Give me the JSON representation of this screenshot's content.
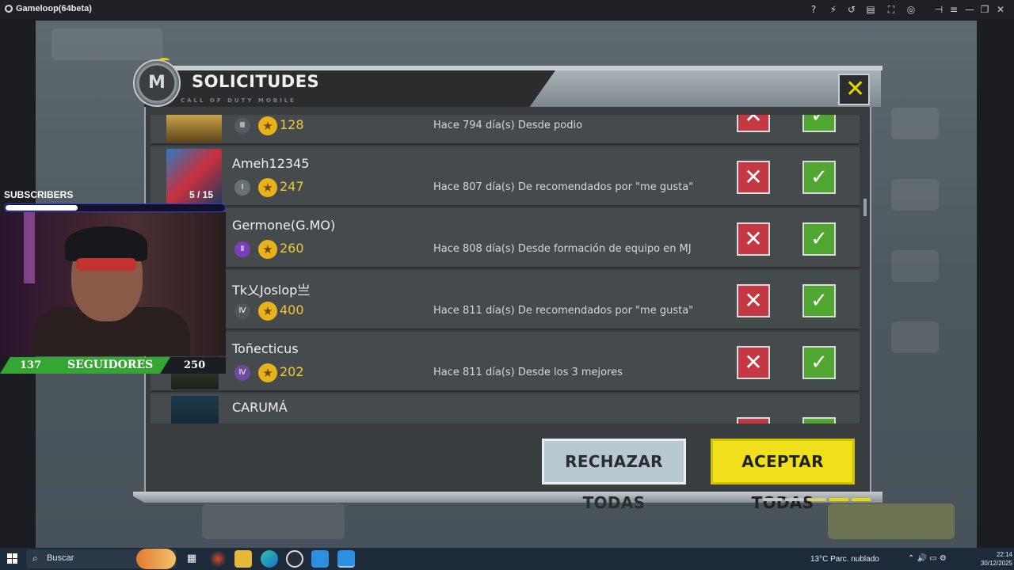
{
  "window": {
    "title": "Gameloop(64beta)"
  },
  "dialog": {
    "title": "SOLICITUDES",
    "subtitle": "CALL OF DUTY MOBILE",
    "reject_all_label": "RECHAZAR TODAS",
    "accept_all_label": "ACEPTAR TODAS"
  },
  "requests": [
    {
      "name": "",
      "level": "128",
      "reason": "Hace 794 día(s) Desde podio"
    },
    {
      "name": "Ameh12345",
      "level": "247",
      "reason": "Hace 807 día(s) De recomendados por \"me gusta\""
    },
    {
      "name": "Germone(G.MO)",
      "level": "260",
      "reason": "Hace 808 día(s) Desde formación de equipo en MJ"
    },
    {
      "name": "Tk乂Joslop亗",
      "level": "400",
      "reason": "Hace 811 día(s) De recomendados por \"me gusta\""
    },
    {
      "name": "Toñecticus",
      "level": "202",
      "reason": "Hace 811 día(s) Desde los 3 mejores"
    },
    {
      "name": "CARUMÁ",
      "level": "",
      "reason": ""
    }
  ],
  "overlay": {
    "subscribers_label": "SUBSCRIBERS",
    "subscribers_count": "5 / 15",
    "subscribers_progress": 0.33,
    "followers_current": "137",
    "followers_label": "SEGUIDORES",
    "followers_goal": "250"
  },
  "taskbar": {
    "search_placeholder": "Buscar",
    "weather": "13°C  Parc. nublado",
    "time": "22:14",
    "date": "30/12/2025"
  },
  "colors": {
    "accent_yellow": "#f0e01c",
    "reject_red": "#c43843",
    "accept_green": "#4fa72f"
  }
}
